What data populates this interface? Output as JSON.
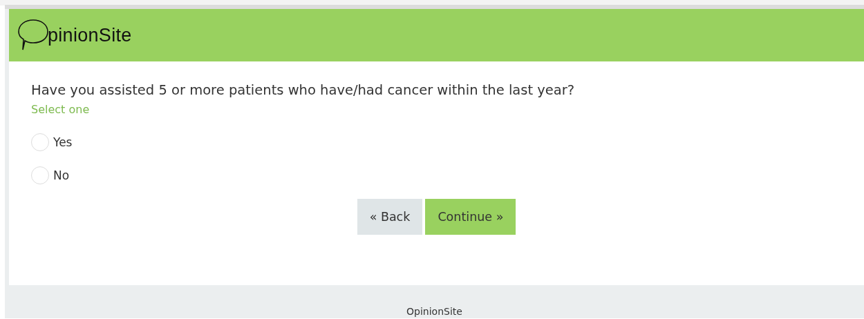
{
  "header": {
    "logo_text": "pinionSite"
  },
  "question": {
    "text": "Have you assisted 5 or more patients who have/had cancer within the last year?",
    "hint": "Select one",
    "options": [
      {
        "label": "Yes",
        "selected": false
      },
      {
        "label": "No",
        "selected": false
      }
    ]
  },
  "buttons": {
    "back": "« Back",
    "continue": "Continue »"
  },
  "footer": {
    "text": "OpinionSite"
  }
}
